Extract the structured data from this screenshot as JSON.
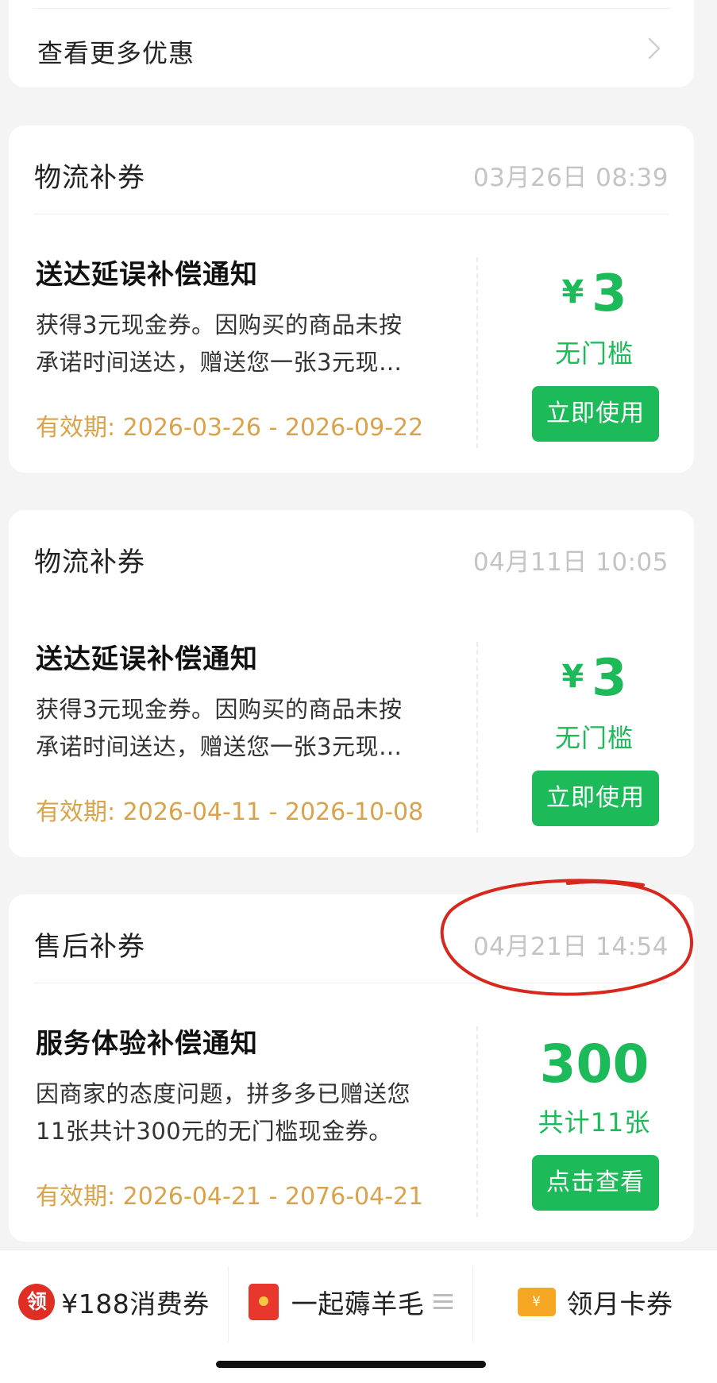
{
  "top": {
    "more_label": "查看更多优惠"
  },
  "cards": [
    {
      "category": "物流补券",
      "time": "03月26日 08:39",
      "title": "送达延误补偿通知",
      "desc_line1": "获得3元现金券。因购买的商品未按",
      "desc_line2": "承诺时间送达，赠送您一张3元现…",
      "validity": "有效期: 2026-03-26 - 2026-09-22",
      "currency": "¥",
      "amount": "3",
      "condition": "无门槛",
      "button": "立即使用"
    },
    {
      "category": "物流补券",
      "time": "04月11日 10:05",
      "title": "送达延误补偿通知",
      "desc_line1": "获得3元现金券。因购买的商品未按",
      "desc_line2": "承诺时间送达，赠送您一张3元现…",
      "validity": "有效期: 2026-04-11 - 2026-10-08",
      "currency": "¥",
      "amount": "3",
      "condition": "无门槛",
      "button": "立即使用"
    },
    {
      "category": "售后补券",
      "time": "04月21日 14:54",
      "title": "服务体验补偿通知",
      "desc_line1": "因商家的态度问题，拼多多已赠送您",
      "desc_line2": "11张共计300元的无门槛现金券。",
      "validity": "有效期: 2026-04-21 - 2076-04-21",
      "amount": "300",
      "condition": "共计11张",
      "button": "点击查看"
    }
  ],
  "bottom_bar": {
    "item1_icon_text": "领",
    "item1_label": "¥188消费券",
    "item2_label": "一起薅羊毛",
    "item3_icon_text": "¥",
    "item3_label": "领月卡券"
  },
  "colors": {
    "accent_green": "#1dba5a",
    "validity_orange": "#dba24a",
    "annotation_red": "#d8281e"
  }
}
